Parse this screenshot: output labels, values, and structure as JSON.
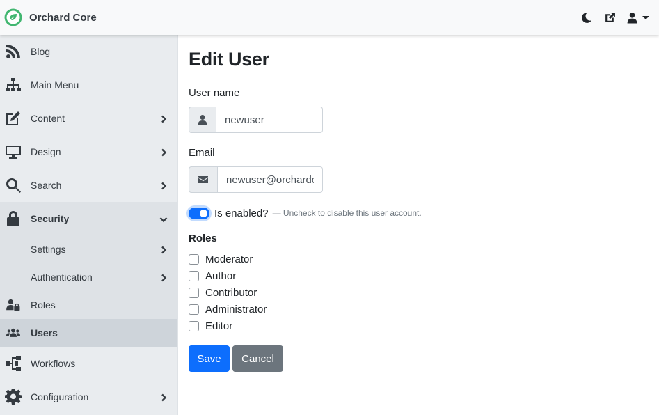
{
  "brand": {
    "name": "Orchard Core"
  },
  "topnav": {
    "icons": [
      "moon-icon",
      "external-link-icon",
      "user-icon"
    ]
  },
  "sidebar": {
    "items": [
      {
        "label": "Blog",
        "icon": "rss-icon",
        "has_children": false
      },
      {
        "label": "Main Menu",
        "icon": "sitemap-icon",
        "has_children": false
      },
      {
        "label": "Content",
        "icon": "edit-icon",
        "has_children": true
      },
      {
        "label": "Design",
        "icon": "monitor-icon",
        "has_children": true
      },
      {
        "label": "Search",
        "icon": "search-icon",
        "has_children": true
      },
      {
        "label": "Security",
        "icon": "lock-icon",
        "has_children": true,
        "expanded": true
      },
      {
        "label": "Workflows",
        "icon": "workflow-icon",
        "has_children": false
      },
      {
        "label": "Configuration",
        "icon": "gear-icon",
        "has_children": true
      }
    ],
    "security_children": [
      {
        "label": "Settings",
        "has_children": true
      },
      {
        "label": "Authentication",
        "has_children": true
      },
      {
        "label": "Roles",
        "icon": "user-lock-icon",
        "has_children": false
      },
      {
        "label": "Users",
        "icon": "users-icon",
        "has_children": false,
        "active": true
      }
    ]
  },
  "form": {
    "title": "Edit User",
    "username": {
      "label": "User name",
      "value": "newuser"
    },
    "email": {
      "label": "Email",
      "value": "newuser@orchardcore.net"
    },
    "enabled": {
      "label": "Is enabled?",
      "hint": "— Uncheck to disable this user account.",
      "checked": true
    },
    "roles": {
      "heading": "Roles",
      "items": [
        "Moderator",
        "Author",
        "Contributor",
        "Administrator",
        "Editor"
      ]
    },
    "save_label": "Save",
    "cancel_label": "Cancel"
  },
  "colors": {
    "primary": "#0d6efd",
    "secondary": "#6c757d",
    "sidebar_bg": "#e9ecef",
    "brand_green": "#41b670"
  }
}
